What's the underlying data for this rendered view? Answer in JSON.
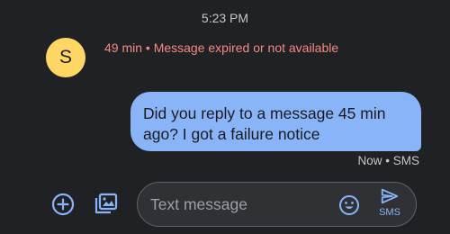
{
  "conversation": {
    "timestamp": "5:23 PM"
  },
  "contact": {
    "avatar_initial": "S"
  },
  "incoming": {
    "status_text": "49 min • Message expired or not available",
    "status_color": "#f28b82"
  },
  "outgoing": {
    "line1": "Did you reply to a message 45 min",
    "line2": "ago? I got a failure notice",
    "meta": "Now • SMS",
    "bubble_color": "#8ab4f8"
  },
  "composer": {
    "placeholder": "Text message",
    "value": "",
    "send_label": "SMS",
    "icons": {
      "add": "add-circle-icon",
      "gallery": "gallery-icon",
      "emoji": "emoji-icon",
      "send": "send-icon"
    }
  },
  "theme": {
    "background": "#202124",
    "accent": "#8ab4f8",
    "avatar_color": "#fdd663"
  }
}
